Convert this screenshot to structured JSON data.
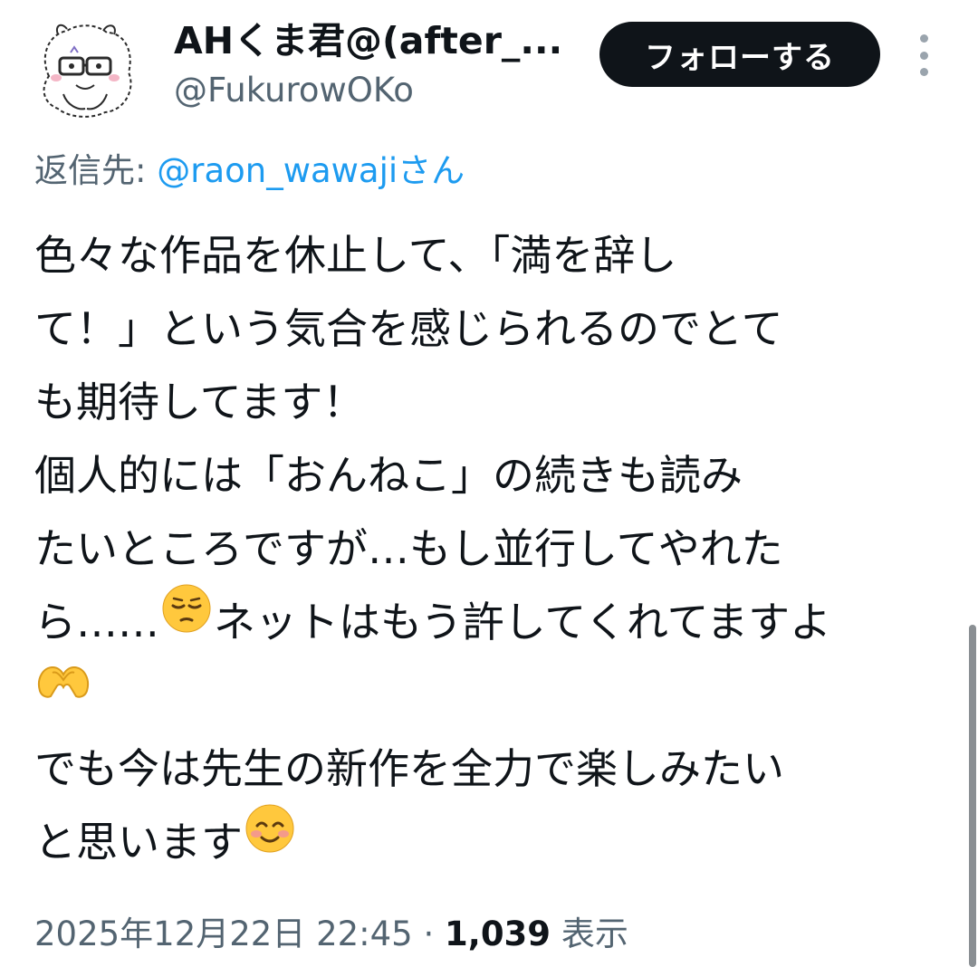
{
  "author": {
    "display_name": "AHくま君@(after_...",
    "handle": "@FukurowOKo",
    "avatar_icon": "sketch-avatar-icon"
  },
  "follow_button": {
    "label": "フォローする"
  },
  "more_menu_icon": "vertical-dots-icon",
  "reply": {
    "prefix": "返信先: ",
    "mention": "@raon_wawajiさん"
  },
  "body": {
    "lines": [
      "色々な作品を休止して、「満を辞し",
      "て！」という気合を感じられるのでとて",
      "も期待してます！",
      "個人的には「おんねこ」の続きも読み",
      "たいところですが…もし並行してやれた",
      "ら……",
      "ネットはもう許してくれてますよ",
      "でも今は先生の新作を全力で楽しみたい",
      "と思います"
    ],
    "emojis": [
      "pensive-face",
      "heart-hands",
      "smiling-face"
    ]
  },
  "meta": {
    "datetime": "2025年12月22日 22:45",
    "separator": " · ",
    "views_count": "1,039",
    "views_label": " 表示"
  },
  "colors": {
    "text": "#0f1419",
    "secondary": "#536471",
    "link": "#1d9bf0",
    "button": "#0f1419"
  }
}
